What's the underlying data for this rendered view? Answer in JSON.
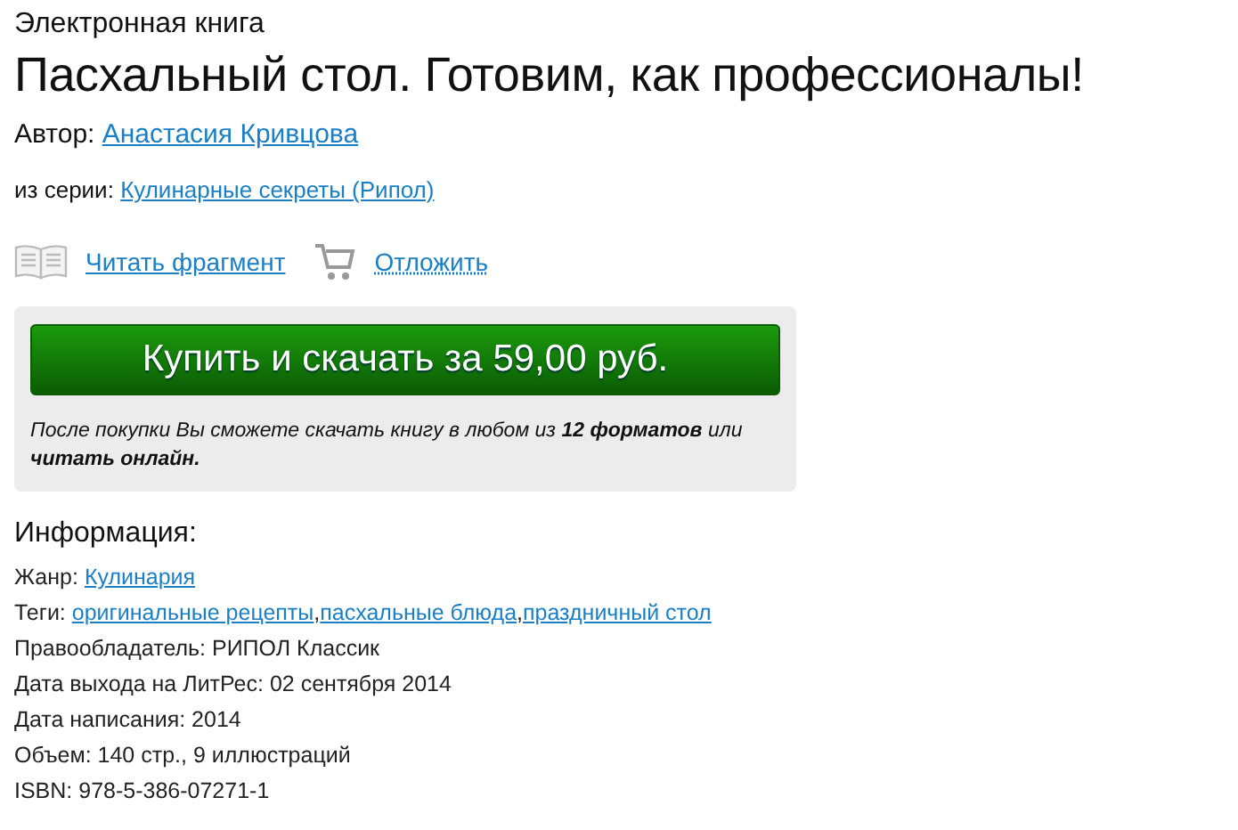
{
  "book_type": "Электронная книга",
  "title": "Пасхальный стол. Готовим, как профессионалы!",
  "author": {
    "label": "Автор:",
    "name": "Анастасия Кривцова"
  },
  "series": {
    "label": "из серии:",
    "name": "Кулинарные секреты (Рипол)"
  },
  "actions": [
    {
      "kind": "read",
      "label": "Читать фрагмент"
    },
    {
      "kind": "cart",
      "label": "Отложить"
    }
  ],
  "purchase": {
    "button": "Купить и скачать за 59,00 руб.",
    "note": "После покупки Вы сможете скачать книгу в любом из **12 форматов** или **читать онлайн.**"
  },
  "info": {
    "heading": "Информация:",
    "rows": [
      {
        "kind": "links",
        "label": "Жанр:",
        "links": [
          "Кулинария"
        ]
      },
      {
        "kind": "links",
        "label": "Теги:",
        "links": [
          "оригинальные рецепты",
          "пасхальные блюда",
          "праздничный стол"
        ],
        "separator": ","
      },
      {
        "kind": "text",
        "text": "Правообладатель: РИПОЛ Классик"
      },
      {
        "kind": "text",
        "text": "Дата выхода на ЛитРес: 02 сентября 2014"
      },
      {
        "kind": "text",
        "text": "Дата написания: 2014"
      },
      {
        "kind": "text",
        "text": "Объем: 140 стр., 9 иллюстраций"
      },
      {
        "kind": "text",
        "text": "ISBN: 978-5-386-07271-1"
      }
    ]
  }
}
